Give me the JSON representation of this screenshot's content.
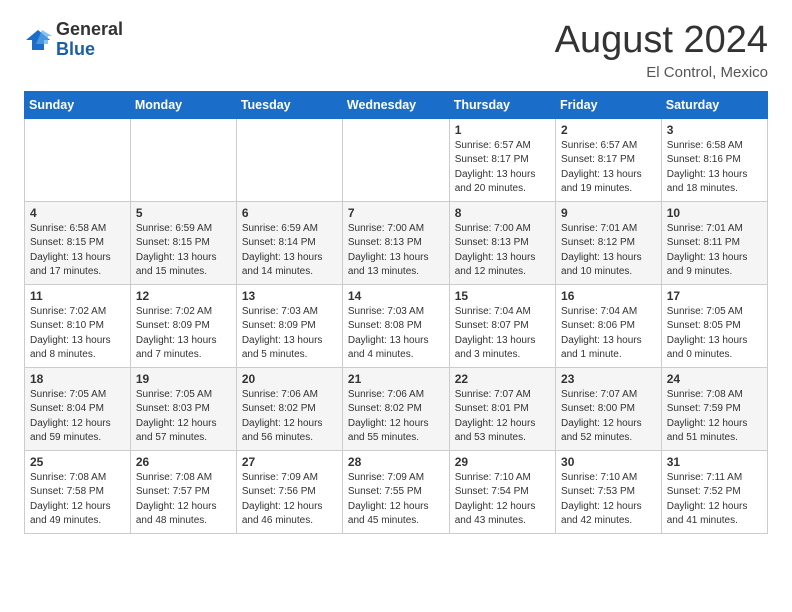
{
  "header": {
    "logo_general": "General",
    "logo_blue": "Blue",
    "title": "August 2024",
    "location": "El Control, Mexico"
  },
  "days_of_week": [
    "Sunday",
    "Monday",
    "Tuesday",
    "Wednesday",
    "Thursday",
    "Friday",
    "Saturday"
  ],
  "weeks": [
    [
      {
        "day": "",
        "info": ""
      },
      {
        "day": "",
        "info": ""
      },
      {
        "day": "",
        "info": ""
      },
      {
        "day": "",
        "info": ""
      },
      {
        "day": "1",
        "info": "Sunrise: 6:57 AM\nSunset: 8:17 PM\nDaylight: 13 hours\nand 20 minutes."
      },
      {
        "day": "2",
        "info": "Sunrise: 6:57 AM\nSunset: 8:17 PM\nDaylight: 13 hours\nand 19 minutes."
      },
      {
        "day": "3",
        "info": "Sunrise: 6:58 AM\nSunset: 8:16 PM\nDaylight: 13 hours\nand 18 minutes."
      }
    ],
    [
      {
        "day": "4",
        "info": "Sunrise: 6:58 AM\nSunset: 8:15 PM\nDaylight: 13 hours\nand 17 minutes."
      },
      {
        "day": "5",
        "info": "Sunrise: 6:59 AM\nSunset: 8:15 PM\nDaylight: 13 hours\nand 15 minutes."
      },
      {
        "day": "6",
        "info": "Sunrise: 6:59 AM\nSunset: 8:14 PM\nDaylight: 13 hours\nand 14 minutes."
      },
      {
        "day": "7",
        "info": "Sunrise: 7:00 AM\nSunset: 8:13 PM\nDaylight: 13 hours\nand 13 minutes."
      },
      {
        "day": "8",
        "info": "Sunrise: 7:00 AM\nSunset: 8:13 PM\nDaylight: 13 hours\nand 12 minutes."
      },
      {
        "day": "9",
        "info": "Sunrise: 7:01 AM\nSunset: 8:12 PM\nDaylight: 13 hours\nand 10 minutes."
      },
      {
        "day": "10",
        "info": "Sunrise: 7:01 AM\nSunset: 8:11 PM\nDaylight: 13 hours\nand 9 minutes."
      }
    ],
    [
      {
        "day": "11",
        "info": "Sunrise: 7:02 AM\nSunset: 8:10 PM\nDaylight: 13 hours\nand 8 minutes."
      },
      {
        "day": "12",
        "info": "Sunrise: 7:02 AM\nSunset: 8:09 PM\nDaylight: 13 hours\nand 7 minutes."
      },
      {
        "day": "13",
        "info": "Sunrise: 7:03 AM\nSunset: 8:09 PM\nDaylight: 13 hours\nand 5 minutes."
      },
      {
        "day": "14",
        "info": "Sunrise: 7:03 AM\nSunset: 8:08 PM\nDaylight: 13 hours\nand 4 minutes."
      },
      {
        "day": "15",
        "info": "Sunrise: 7:04 AM\nSunset: 8:07 PM\nDaylight: 13 hours\nand 3 minutes."
      },
      {
        "day": "16",
        "info": "Sunrise: 7:04 AM\nSunset: 8:06 PM\nDaylight: 13 hours\nand 1 minute."
      },
      {
        "day": "17",
        "info": "Sunrise: 7:05 AM\nSunset: 8:05 PM\nDaylight: 13 hours\nand 0 minutes."
      }
    ],
    [
      {
        "day": "18",
        "info": "Sunrise: 7:05 AM\nSunset: 8:04 PM\nDaylight: 12 hours\nand 59 minutes."
      },
      {
        "day": "19",
        "info": "Sunrise: 7:05 AM\nSunset: 8:03 PM\nDaylight: 12 hours\nand 57 minutes."
      },
      {
        "day": "20",
        "info": "Sunrise: 7:06 AM\nSunset: 8:02 PM\nDaylight: 12 hours\nand 56 minutes."
      },
      {
        "day": "21",
        "info": "Sunrise: 7:06 AM\nSunset: 8:02 PM\nDaylight: 12 hours\nand 55 minutes."
      },
      {
        "day": "22",
        "info": "Sunrise: 7:07 AM\nSunset: 8:01 PM\nDaylight: 12 hours\nand 53 minutes."
      },
      {
        "day": "23",
        "info": "Sunrise: 7:07 AM\nSunset: 8:00 PM\nDaylight: 12 hours\nand 52 minutes."
      },
      {
        "day": "24",
        "info": "Sunrise: 7:08 AM\nSunset: 7:59 PM\nDaylight: 12 hours\nand 51 minutes."
      }
    ],
    [
      {
        "day": "25",
        "info": "Sunrise: 7:08 AM\nSunset: 7:58 PM\nDaylight: 12 hours\nand 49 minutes."
      },
      {
        "day": "26",
        "info": "Sunrise: 7:08 AM\nSunset: 7:57 PM\nDaylight: 12 hours\nand 48 minutes."
      },
      {
        "day": "27",
        "info": "Sunrise: 7:09 AM\nSunset: 7:56 PM\nDaylight: 12 hours\nand 46 minutes."
      },
      {
        "day": "28",
        "info": "Sunrise: 7:09 AM\nSunset: 7:55 PM\nDaylight: 12 hours\nand 45 minutes."
      },
      {
        "day": "29",
        "info": "Sunrise: 7:10 AM\nSunset: 7:54 PM\nDaylight: 12 hours\nand 43 minutes."
      },
      {
        "day": "30",
        "info": "Sunrise: 7:10 AM\nSunset: 7:53 PM\nDaylight: 12 hours\nand 42 minutes."
      },
      {
        "day": "31",
        "info": "Sunrise: 7:11 AM\nSunset: 7:52 PM\nDaylight: 12 hours\nand 41 minutes."
      }
    ]
  ]
}
